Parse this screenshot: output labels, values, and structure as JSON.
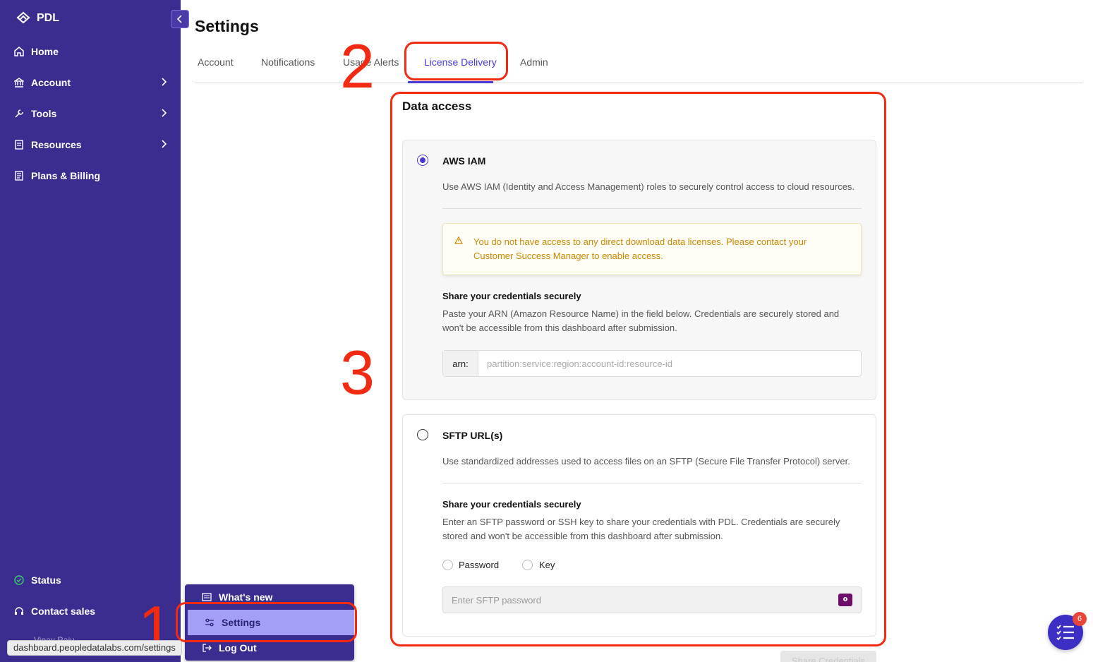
{
  "sidebar": {
    "brand": "PDL",
    "nav": [
      {
        "label": "Home",
        "icon": "home-icon"
      },
      {
        "label": "Account",
        "icon": "bank-icon"
      },
      {
        "label": "Tools",
        "icon": "tools-icon"
      },
      {
        "label": "Resources",
        "icon": "document-icon"
      },
      {
        "label": "Plans & Billing",
        "icon": "billing-icon"
      }
    ],
    "bottom": [
      {
        "label": "Status",
        "icon": "check-circle-icon"
      },
      {
        "label": "Contact sales",
        "icon": "headset-icon"
      }
    ],
    "user_partial": "Vinay Raju"
  },
  "popup_menu": {
    "items": [
      {
        "label": "What's new",
        "icon": "newspaper-icon"
      },
      {
        "label": "Settings",
        "icon": "sliders-icon"
      },
      {
        "label": "Log Out",
        "icon": "logout-icon"
      }
    ]
  },
  "status_url": "dashboard.peopledatalabs.com/settings",
  "page": {
    "title": "Settings",
    "tabs": [
      "Account",
      "Notifications",
      "Usage Alerts",
      "License Delivery",
      "Admin"
    ],
    "active_tab": "License Delivery"
  },
  "data_access": {
    "title": "Data access",
    "aws": {
      "title": "AWS IAM",
      "description": "Use AWS IAM (Identity and Access Management) roles to securely control access to cloud resources.",
      "warning": "You do not have access to any direct download data licenses. Please contact your Customer Success Manager to enable access.",
      "share_title": "Share your credentials securely",
      "share_text": "Paste your ARN (Amazon Resource Name) in the field below. Credentials are securely stored and won't be accessible from this dashboard after submission.",
      "arn_prefix": "arn:",
      "arn_placeholder": "partition:service:region:account-id:resource-id",
      "selected": true
    },
    "sftp": {
      "title": "SFTP URL(s)",
      "description": "Use standardized addresses used to access files on an SFTP (Secure File Transfer Protocol) server.",
      "share_title": "Share your credentials securely",
      "share_text": "Enter an SFTP password or SSH key to share your credentials with PDL. Credentials are securely stored and won't be accessible from this dashboard after submission.",
      "options": [
        "Password",
        "Key"
      ],
      "password_placeholder": "Enter SFTP password",
      "selected": false
    },
    "save_label": "Share Credentials"
  },
  "annotations": [
    "1",
    "2",
    "3"
  ],
  "notifications_badge": "6",
  "colors": {
    "sidebar": "#3b2d8f",
    "accent": "#4a3bd6",
    "warning": "#c98a00",
    "annotation": "#f22a12"
  }
}
